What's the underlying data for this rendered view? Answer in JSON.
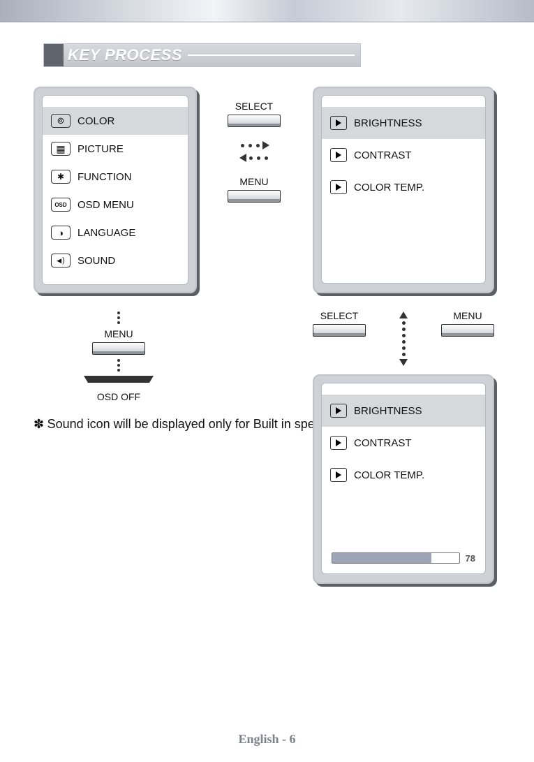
{
  "section_title": "KEY PROCESS",
  "main_menu": {
    "items": [
      {
        "label": "COLOR",
        "icon": "circles-icon",
        "selected": true
      },
      {
        "label": "PICTURE",
        "icon": "grid-icon",
        "selected": false
      },
      {
        "label": "FUNCTION",
        "icon": "gears-icon",
        "selected": false
      },
      {
        "label": "OSD MENU",
        "icon": "osd-icon",
        "selected": false
      },
      {
        "label": "LANGUAGE",
        "icon": "globe-icon",
        "selected": false
      },
      {
        "label": "SOUND",
        "icon": "speaker-icon",
        "selected": false
      }
    ]
  },
  "sub_menu": {
    "items": [
      {
        "label": "BRIGHTNESS",
        "selected": true
      },
      {
        "label": "CONTRAST",
        "selected": false
      },
      {
        "label": "COLOR TEMP.",
        "selected": false
      }
    ]
  },
  "adjust_menu": {
    "items": [
      {
        "label": "BRIGHTNESS",
        "selected": true
      },
      {
        "label": "CONTRAST",
        "selected": false
      },
      {
        "label": "COLOR TEMP.",
        "selected": false
      }
    ],
    "slider_value": 78,
    "slider_max": 100
  },
  "buttons": {
    "select": "SELECT",
    "menu": "MENU"
  },
  "left_flow": {
    "menu": "MENU",
    "osd_off": "OSD OFF"
  },
  "note_text": "Sound icon will be displayed only for Built in speaker model.",
  "footer": "English - 6"
}
